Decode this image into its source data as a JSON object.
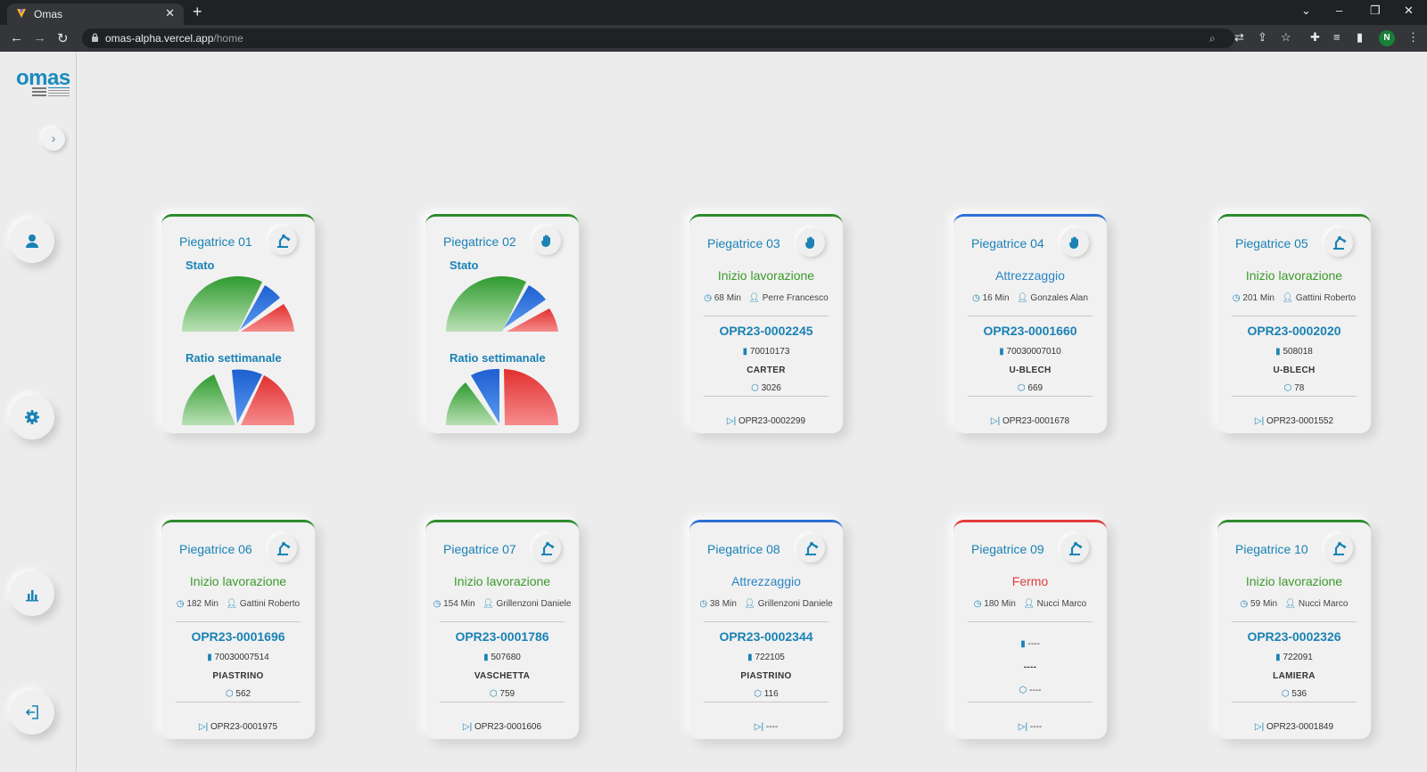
{
  "browser": {
    "tab_title": "Omas",
    "tab_close": "✕",
    "new_tab": "+",
    "url_host": "omas-alpha.vercel.app",
    "url_path": "/home",
    "profile_initial": "N",
    "window_controls": [
      "⌄",
      "–",
      "❐",
      "✕"
    ]
  },
  "app": {
    "logo_text": "omas",
    "expander_icon": "chevron-right-icon",
    "nav": [
      {
        "icon": "user-icon"
      },
      {
        "icon": "gear-icon"
      },
      {
        "icon": "bar-chart-icon"
      },
      {
        "icon": "logout-icon"
      }
    ],
    "colors": {
      "accent": "#1a82b5",
      "green": "#3a9a2a",
      "blue": "#2d6fd6",
      "red": "#e23b3b"
    }
  },
  "cards": [
    {
      "title": "Piegatrice 01",
      "type": "gauge",
      "icon": "robot-arm-icon",
      "color": "green",
      "stato_label": "Stato",
      "ratio_label": "Ratio settimanale"
    },
    {
      "title": "Piegatrice 02",
      "type": "gauge",
      "icon": "hand-icon",
      "color": "green",
      "stato_label": "Stato",
      "ratio_label": "Ratio settimanale"
    },
    {
      "title": "Piegatrice 03",
      "type": "status",
      "icon": "hand-icon",
      "color": "green",
      "status": "Inizio lavorazione",
      "status_color": "green",
      "minutes": "68 Min",
      "operator": "Perre Francesco",
      "order": "OPR23-0002245",
      "code": "70010173",
      "material": "CARTER",
      "quantity": "3026",
      "next_order": "OPR23-0002299"
    },
    {
      "title": "Piegatrice 04",
      "type": "status",
      "icon": "hand-icon",
      "color": "blue",
      "status": "Attrezzaggio",
      "status_color": "blue",
      "minutes": "16 Min",
      "operator": "Gonzales Alan",
      "order": "OPR23-0001660",
      "code": "70030007010",
      "material": "U-BLECH",
      "quantity": "669",
      "next_order": "OPR23-0001678"
    },
    {
      "title": "Piegatrice 05",
      "type": "status",
      "icon": "robot-arm-icon",
      "color": "green",
      "status": "Inizio lavorazione",
      "status_color": "green",
      "minutes": "201 Min",
      "operator": "Gattini Roberto",
      "order": "OPR23-0002020",
      "code": "508018",
      "material": "U-BLECH",
      "quantity": "78",
      "next_order": "OPR23-0001552"
    },
    {
      "title": "Piegatrice 06",
      "type": "status",
      "icon": "robot-arm-icon",
      "color": "green",
      "status": "Inizio lavorazione",
      "status_color": "green",
      "minutes": "182 Min",
      "operator": "Gattini Roberto",
      "order": "OPR23-0001696",
      "code": "70030007514",
      "material": "PIASTRINO",
      "quantity": "562",
      "next_order": "OPR23-0001975"
    },
    {
      "title": "Piegatrice 07",
      "type": "status",
      "icon": "robot-arm-icon",
      "color": "green",
      "status": "Inizio lavorazione",
      "status_color": "green",
      "minutes": "154 Min",
      "operator": "Grillenzoni Daniele",
      "order": "OPR23-0001786",
      "code": "507680",
      "material": "VASCHETTA",
      "quantity": "759",
      "next_order": "OPR23-0001606"
    },
    {
      "title": "Piegatrice 08",
      "type": "status",
      "icon": "robot-arm-icon",
      "color": "blue",
      "status": "Attrezzaggio",
      "status_color": "blue",
      "minutes": "38 Min",
      "operator": "Grillenzoni Daniele",
      "order": "OPR23-0002344",
      "code": "722105",
      "material": "PIASTRINO",
      "quantity": "116",
      "next_order": "----"
    },
    {
      "title": "Piegatrice 09",
      "type": "status",
      "icon": "robot-arm-icon",
      "color": "red",
      "status": "Fermo",
      "status_color": "red",
      "minutes": "180 Min",
      "operator": "Nucci Marco",
      "order": "",
      "code": "----",
      "material": "----",
      "quantity": "----",
      "next_order": "----",
      "empty": true
    },
    {
      "title": "Piegatrice 10",
      "type": "status",
      "icon": "robot-arm-icon",
      "color": "green",
      "status": "Inizio lavorazione",
      "status_color": "green",
      "minutes": "59 Min",
      "operator": "Nucci Marco",
      "order": "OPR23-0002326",
      "code": "722091",
      "material": "LAMIERA",
      "quantity": "536",
      "next_order": "OPR23-0001849"
    }
  ]
}
